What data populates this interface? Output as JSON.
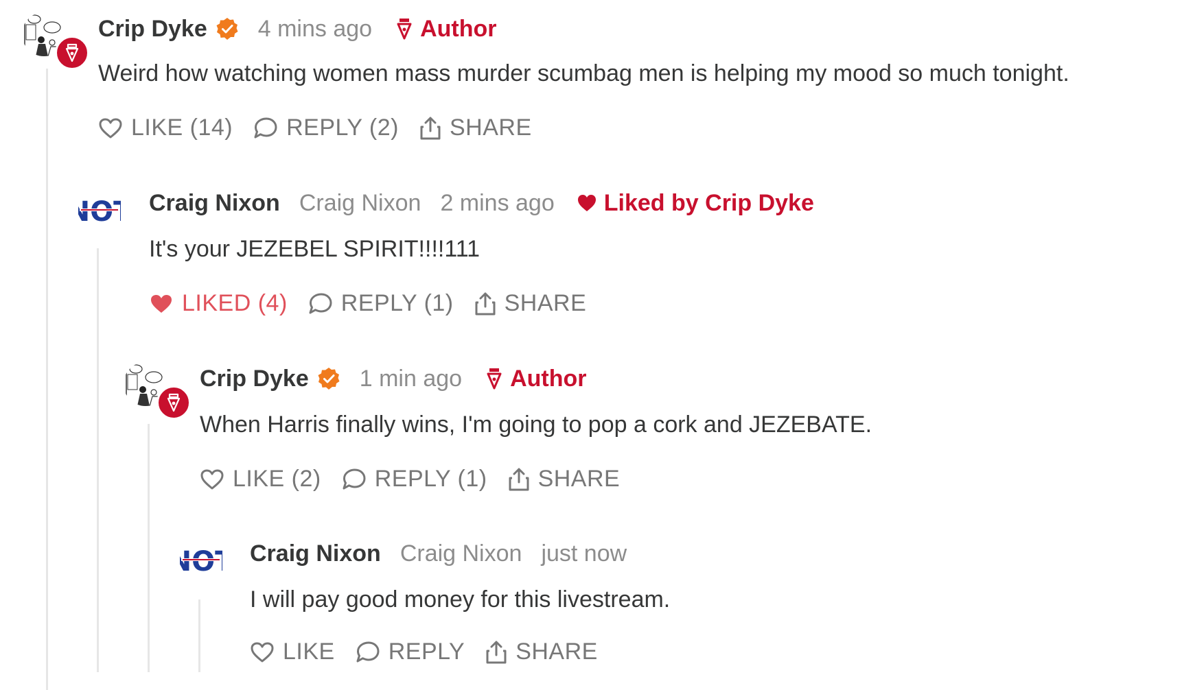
{
  "comments": [
    {
      "name": "Crip Dyke",
      "handle": "",
      "time": "4 mins ago",
      "badge": "Author",
      "text": "Weird how watching women mass murder scumbag men is helping my mood so much tonight.",
      "like_label": "LIKE (14)",
      "reply_label": "REPLY (2)",
      "share_label": "SHARE"
    },
    {
      "name": "Craig Nixon",
      "handle": "Craig Nixon",
      "time": "2 mins ago",
      "liked_by": "Liked by Crip Dyke",
      "text": "It's your JEZEBEL SPIRIT!!!!111",
      "like_label": "LIKED (4)",
      "reply_label": "REPLY (1)",
      "share_label": "SHARE"
    },
    {
      "name": "Crip Dyke",
      "handle": "",
      "time": "1 min ago",
      "badge": "Author",
      "text": "When Harris finally wins, I'm going to pop a cork and JEZEBATE.",
      "like_label": "LIKE (2)",
      "reply_label": "REPLY (1)",
      "share_label": "SHARE"
    },
    {
      "name": "Craig Nixon",
      "handle": "Craig Nixon",
      "time": "just now",
      "text": "I will pay good money for this livestream.",
      "like_label": "LIKE",
      "reply_label": "REPLY",
      "share_label": "SHARE"
    }
  ],
  "avatar_logo_text": "NOT",
  "colors": {
    "accent_red": "#c8102e",
    "liked_red": "#e0505a",
    "verified_orange": "#f07b1d",
    "muted": "#8c8c8c",
    "not_blue": "#1f3d99"
  },
  "icons": [
    "heart-outline-icon",
    "heart-filled-icon",
    "comment-bubble-icon",
    "share-icon",
    "more-dots-icon",
    "verified-check-icon",
    "fountain-pen-icon"
  ]
}
